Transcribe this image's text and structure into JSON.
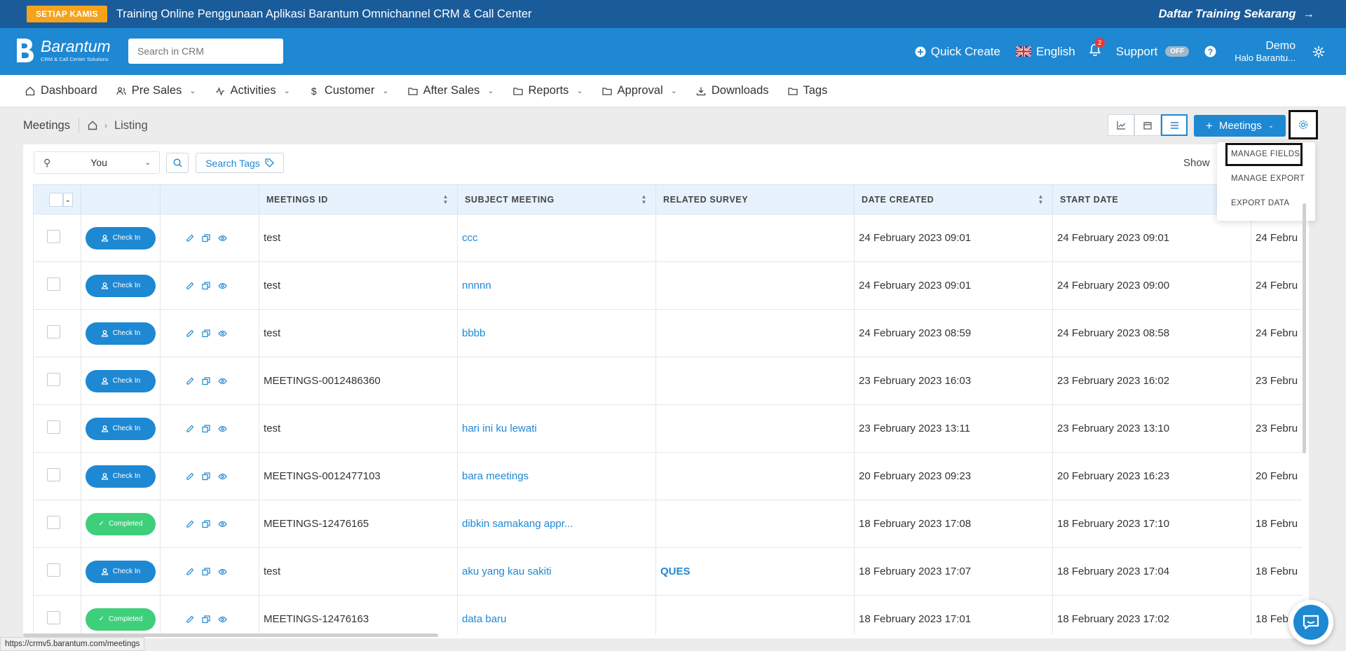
{
  "promo": {
    "badge": "SETIAP KAMIS",
    "text": "Training Online Penggunaan Aplikasi Barantum Omnichannel CRM & Call Center",
    "cta": "Daftar Training Sekarang"
  },
  "header": {
    "logo_name": "Barantum",
    "logo_sub": "CRM & Call Center Solutions",
    "search_placeholder": "Search in CRM",
    "quick_create": "Quick Create",
    "language": "English",
    "notif_count": "2",
    "support": "Support",
    "support_toggle": "OFF",
    "user_name": "Demo",
    "user_sub": "Halo Barantu..."
  },
  "nav": {
    "items": [
      {
        "label": "Dashboard",
        "icon": "home-icon"
      },
      {
        "label": "Pre Sales",
        "icon": "users-icon"
      },
      {
        "label": "Activities",
        "icon": "activity-icon"
      },
      {
        "label": "Customer",
        "icon": "dollar-icon"
      },
      {
        "label": "After Sales",
        "icon": "folder-icon"
      },
      {
        "label": "Reports",
        "icon": "folder-icon"
      },
      {
        "label": "Approval",
        "icon": "folder-icon"
      },
      {
        "label": "Downloads",
        "icon": "download-icon"
      },
      {
        "label": "Tags",
        "icon": "folder-icon"
      }
    ]
  },
  "breadcrumb": {
    "page": "Meetings",
    "current": "Listing"
  },
  "toolbar": {
    "add_label": "Meetings",
    "filter_value": "You",
    "search_tags": "Search Tags",
    "show_label": "Show"
  },
  "dropdown": {
    "items": [
      "MANAGE FIELDS",
      "MANAGE EXPORT",
      "EXPORT DATA"
    ]
  },
  "table": {
    "columns": [
      "MEETINGS ID",
      "SUBJECT MEETING",
      "RELATED SURVEY",
      "DATE CREATED",
      "START DATE"
    ],
    "rows": [
      {
        "status": "Check In",
        "id": "test",
        "subject": "ccc",
        "survey": "",
        "created": "24 February 2023 09:01",
        "start": "24 February 2023 09:01",
        "extra": "24 Febru"
      },
      {
        "status": "Check In",
        "id": "test",
        "subject": "nnnnn",
        "survey": "",
        "created": "24 February 2023 09:01",
        "start": "24 February 2023 09:00",
        "extra": "24 Febru"
      },
      {
        "status": "Check In",
        "id": "test",
        "subject": "bbbb",
        "survey": "",
        "created": "24 February 2023 08:59",
        "start": "24 February 2023 08:58",
        "extra": "24 Febru"
      },
      {
        "status": "Check In",
        "id": "MEETINGS-0012486360",
        "subject": "",
        "survey": "",
        "created": "23 February 2023 16:03",
        "start": "23 February 2023 16:02",
        "extra": "23 Febru"
      },
      {
        "status": "Check In",
        "id": "test",
        "subject": "hari ini ku lewati",
        "survey": "",
        "created": "23 February 2023 13:11",
        "start": "23 February 2023 13:10",
        "extra": "23 Febru"
      },
      {
        "status": "Check In",
        "id": "MEETINGS-0012477103",
        "subject": "bara meetings",
        "survey": "",
        "created": "20 February 2023 09:23",
        "start": "20 February 2023 16:23",
        "extra": "20 Febru"
      },
      {
        "status": "Completed",
        "id": "MEETINGS-12476165",
        "subject": "dibkin samakang appr...",
        "survey": "",
        "created": "18 February 2023 17:08",
        "start": "18 February 2023 17:10",
        "extra": "18 Febru"
      },
      {
        "status": "Check In",
        "id": "test",
        "subject": "aku yang kau sakiti",
        "survey": "QUES",
        "created": "18 February 2023 17:07",
        "start": "18 February 2023 17:04",
        "extra": "18 Febru"
      },
      {
        "status": "Completed",
        "id": "MEETINGS-12476163",
        "subject": "data baru",
        "survey": "",
        "created": "18 February 2023 17:01",
        "start": "18 February 2023 17:02",
        "extra": "18 Feb"
      }
    ]
  },
  "status_url": "https://crmv5.barantum.com/meetings",
  "colors": {
    "primary": "#1e88d3",
    "promo_bg": "#1a5b9a",
    "badge": "#f6a21d",
    "completed": "#3ecf7a"
  }
}
